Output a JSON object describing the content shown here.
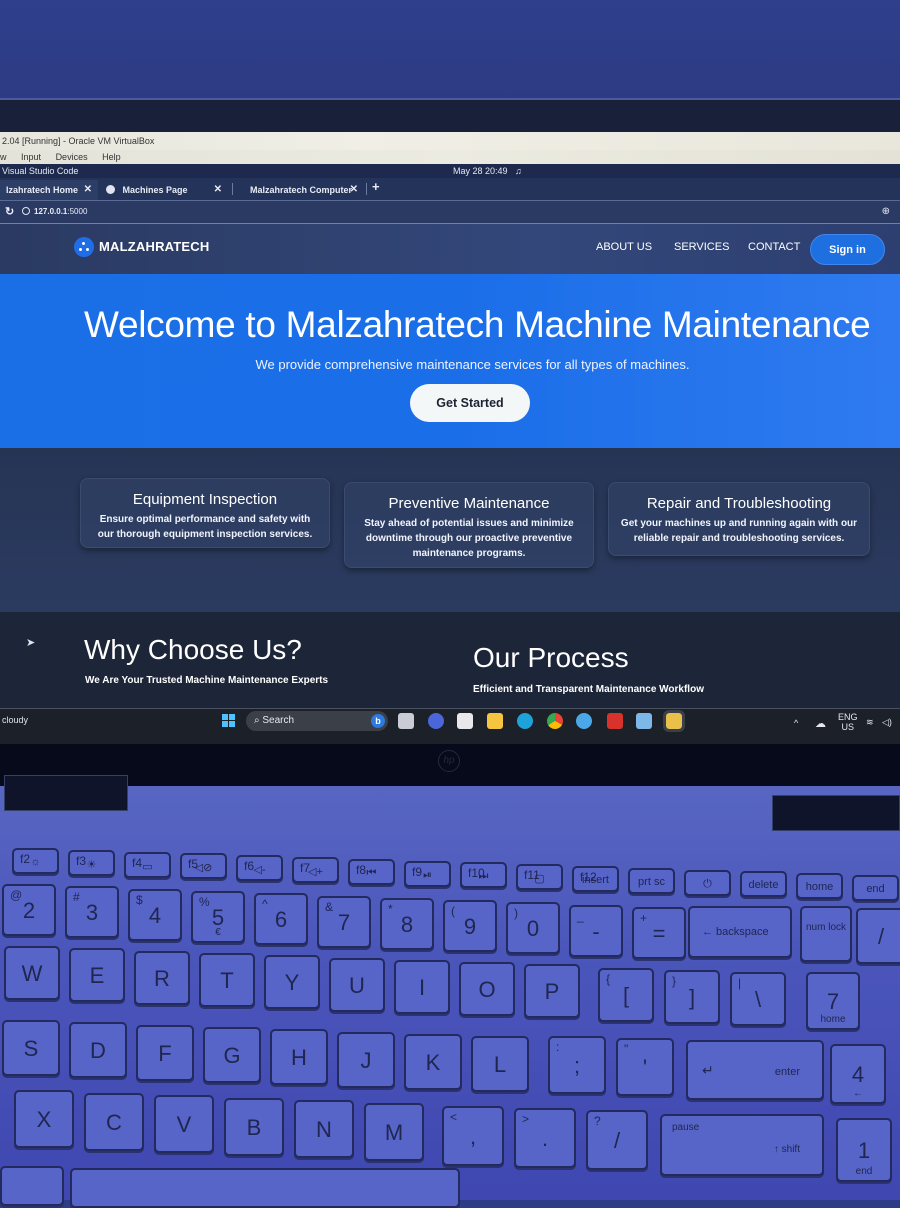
{
  "host": {
    "vbox_title": "2.04 [Running] - Oracle VM VirtualBox",
    "vbox_menu": [
      "w",
      "Input",
      "Devices",
      "Help"
    ]
  },
  "guest_topbar": {
    "app_name": "Visual Studio Code",
    "clock": "May 28  20:49"
  },
  "browser": {
    "tabs": [
      {
        "label": "lzahratech Home",
        "active": true
      },
      {
        "label": "Machines Page",
        "active": false
      },
      {
        "label": "Malzahratech Computer",
        "active": false
      }
    ],
    "url_host": "127.0.0.1",
    "url_port": ":5000"
  },
  "site": {
    "brand": "MALZAHRATECH",
    "nav": [
      "ABOUT US",
      "SERVICES",
      "CONTACT"
    ],
    "signin": "Sign in",
    "hero": {
      "title": "Welcome to Malzahratech Machine Maintenance",
      "subtitle": "We provide comprehensive maintenance services for all types of machines.",
      "cta": "Get Started"
    },
    "services": [
      {
        "title": "Equipment Inspection",
        "text": "Ensure optimal performance and safety with our thorough equipment inspection services."
      },
      {
        "title": "Preventive Maintenance",
        "text": "Stay ahead of potential issues and minimize downtime through our proactive preventive maintenance programs."
      },
      {
        "title": "Repair and Troubleshooting",
        "text": "Get your machines up and running again with our reliable repair and troubleshooting services."
      }
    ],
    "why": {
      "title": "Why Choose Us?",
      "subtitle": "We Are Your Trusted Machine Maintenance Experts"
    },
    "process": {
      "title": "Our Process",
      "subtitle": "Efficient and Transparent Maintenance Workflow"
    },
    "colors": {
      "primary": "#1b6fe6",
      "nav_bg": "#2d3f70",
      "dark_bg": "#1d2638"
    }
  },
  "taskbar": {
    "weather": "cloudy",
    "search_label": "Search",
    "lang_top": "ENG",
    "lang_bottom": "US",
    "apps": [
      "task-view",
      "teams-meet",
      "store",
      "file-explorer",
      "edge",
      "chrome",
      "weather-app",
      "mcafee",
      "virtualbox",
      "terminal-app"
    ]
  },
  "laptop": {
    "logo": "hp"
  },
  "keyboard": {
    "fn_row": [
      {
        "fn": "f2",
        "label": "☼"
      },
      {
        "fn": "f3",
        "label": "☀"
      },
      {
        "fn": "f4",
        "label": "▭"
      },
      {
        "fn": "f5",
        "label": "◁⊘"
      },
      {
        "fn": "f6",
        "label": "◁-"
      },
      {
        "fn": "f7",
        "label": "◁+"
      },
      {
        "fn": "f8",
        "label": "⏮"
      },
      {
        "fn": "f9",
        "label": "⏯"
      },
      {
        "fn": "f10",
        "label": "⏭"
      },
      {
        "fn": "f11",
        "label": "▢"
      },
      {
        "fn": "f12",
        "label": "insert"
      },
      {
        "fn": "",
        "label": "prt sc"
      },
      {
        "fn": "",
        "label": "⏻"
      },
      {
        "fn": "",
        "label": "delete"
      },
      {
        "fn": "",
        "label": "home"
      },
      {
        "fn": "",
        "label": "end"
      }
    ],
    "num_row": [
      {
        "top": "@",
        "main": "2"
      },
      {
        "top": "#",
        "main": "3"
      },
      {
        "top": "$",
        "main": "4"
      },
      {
        "top": "%",
        "main": "5",
        "sub": "€"
      },
      {
        "top": "^",
        "main": "6"
      },
      {
        "top": "&",
        "main": "7"
      },
      {
        "top": "*",
        "main": "8"
      },
      {
        "top": "(",
        "main": "9"
      },
      {
        "top": ")",
        "main": "0"
      },
      {
        "top": "_",
        "main": "-"
      },
      {
        "top": "+",
        "main": "="
      }
    ],
    "backspace": "backspace",
    "num_lock": "num lock",
    "num_slash": "/",
    "row_q": [
      "W",
      "E",
      "R",
      "T",
      "Y",
      "U",
      "I",
      "O",
      "P"
    ],
    "row_q_extra": [
      {
        "top": "{",
        "main": "["
      },
      {
        "top": "}",
        "main": "]"
      },
      {
        "top": "|",
        "main": "\\"
      }
    ],
    "num7": {
      "main": "7",
      "sub": "home"
    },
    "row_a": [
      "S",
      "D",
      "F",
      "G",
      "H",
      "J",
      "K",
      "L"
    ],
    "row_a_extra": [
      {
        "top": ":",
        "main": ";"
      },
      {
        "top": "\"",
        "main": "'"
      }
    ],
    "enter": "enter",
    "num4": {
      "main": "4",
      "sub": "←"
    },
    "row_z": [
      "X",
      "C",
      "V",
      "B",
      "N",
      "M"
    ],
    "row_z_extra": [
      {
        "top": "<",
        "main": ","
      },
      {
        "top": ">",
        "main": "."
      },
      {
        "top": "?",
        "main": "/"
      }
    ],
    "shift": "shift",
    "shift_pause": "pause",
    "num1": {
      "main": "1",
      "sub": "end"
    }
  }
}
